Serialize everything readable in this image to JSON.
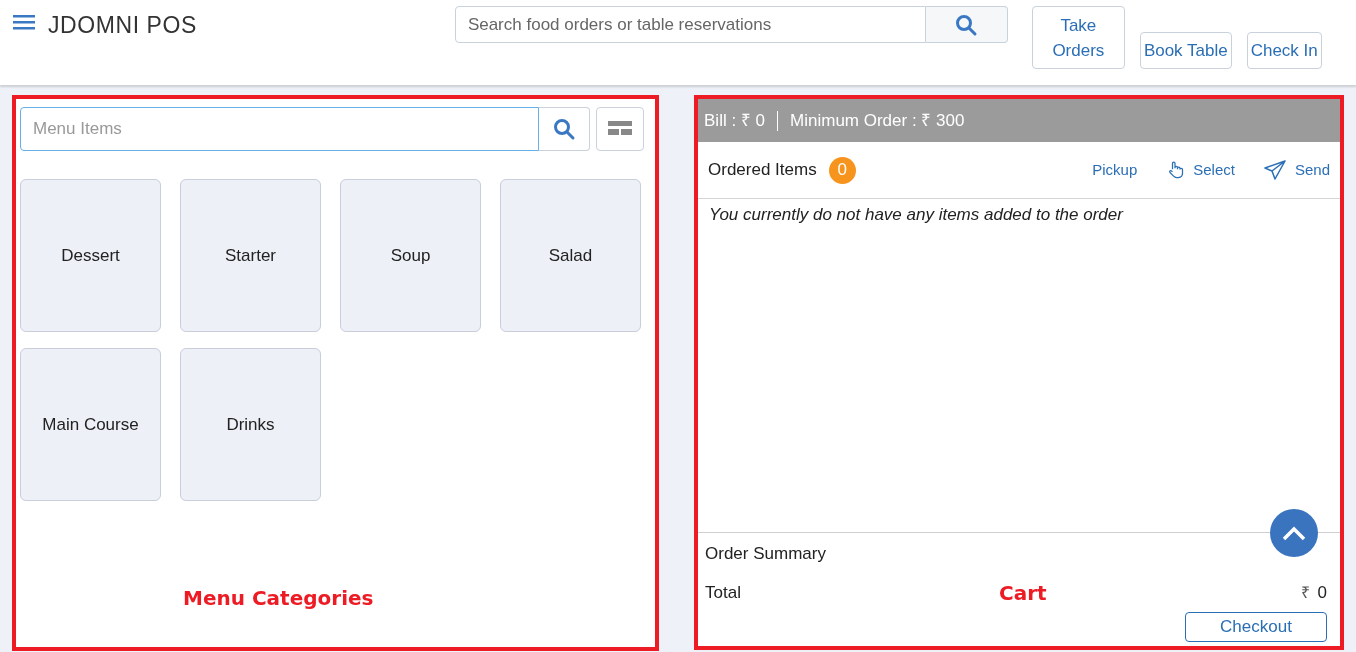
{
  "header": {
    "brand": "JDOMNI POS",
    "search": {
      "placeholder": "Search food orders or table reservations"
    },
    "buttons": [
      {
        "label": "Take Orders",
        "tall": true
      },
      {
        "label": "Book Table",
        "tall": false
      },
      {
        "label": "Check In",
        "tall": false
      }
    ]
  },
  "menu": {
    "search": {
      "placeholder": "Menu Items"
    },
    "categories": [
      "Dessert",
      "Starter",
      "Soup",
      "Salad",
      "Main Course",
      "Drinks"
    ],
    "annotation": "Menu Categories"
  },
  "cart": {
    "bill": "Bill : ₹ 0",
    "minimum": "Minimum Order : ₹ 300",
    "ordered_label": "Ordered Items",
    "count": "0",
    "actions": [
      {
        "kind": "text",
        "label": "Pickup"
      },
      {
        "kind": "hand",
        "label": "Select"
      },
      {
        "kind": "send",
        "label": "Send"
      }
    ],
    "empty_message": "You currently do not have any items added to the order",
    "summary_title": "Order Summary",
    "total_label": "Total",
    "total_currency": "₹",
    "total_value": "0",
    "annotation": "Cart",
    "checkout": "Checkout"
  }
}
